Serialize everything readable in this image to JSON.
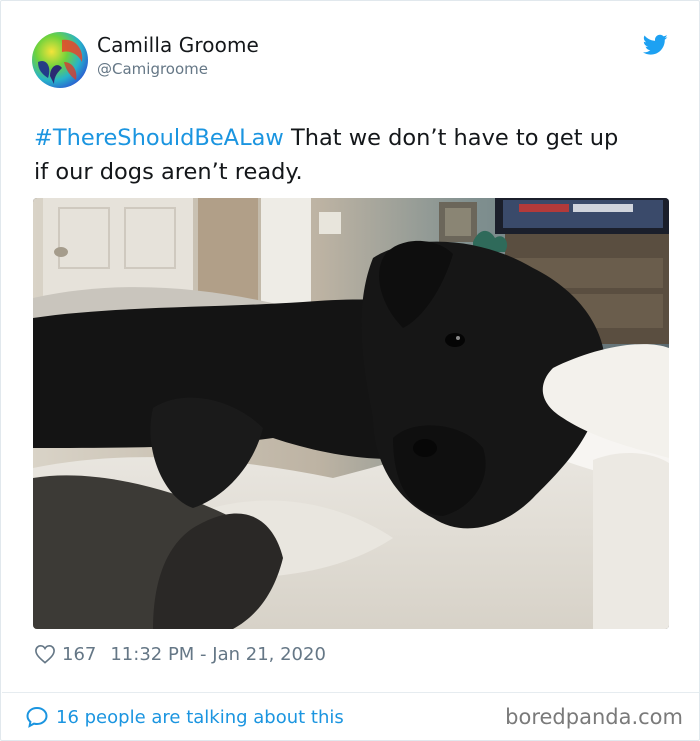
{
  "tweet": {
    "author_name": "Camilla Groome",
    "author_handle": "@Camigroome",
    "hashtag": "#ThereShouldBeALaw",
    "text_line1": " That we don’t have to get up",
    "text_line2": "if our dogs aren’t ready.",
    "like_count": "167",
    "timestamp": "11:32 PM - Jan 21, 2020",
    "talking_text": "16 people are talking about this",
    "watermark": "boredpanda.com"
  },
  "icons": {
    "logo": "twitter-bird-icon",
    "like": "heart-icon",
    "reply": "speech-bubble-icon"
  },
  "colors": {
    "accent": "#1b95e0",
    "secondary_text": "#657786",
    "primary_text": "#14171a"
  }
}
